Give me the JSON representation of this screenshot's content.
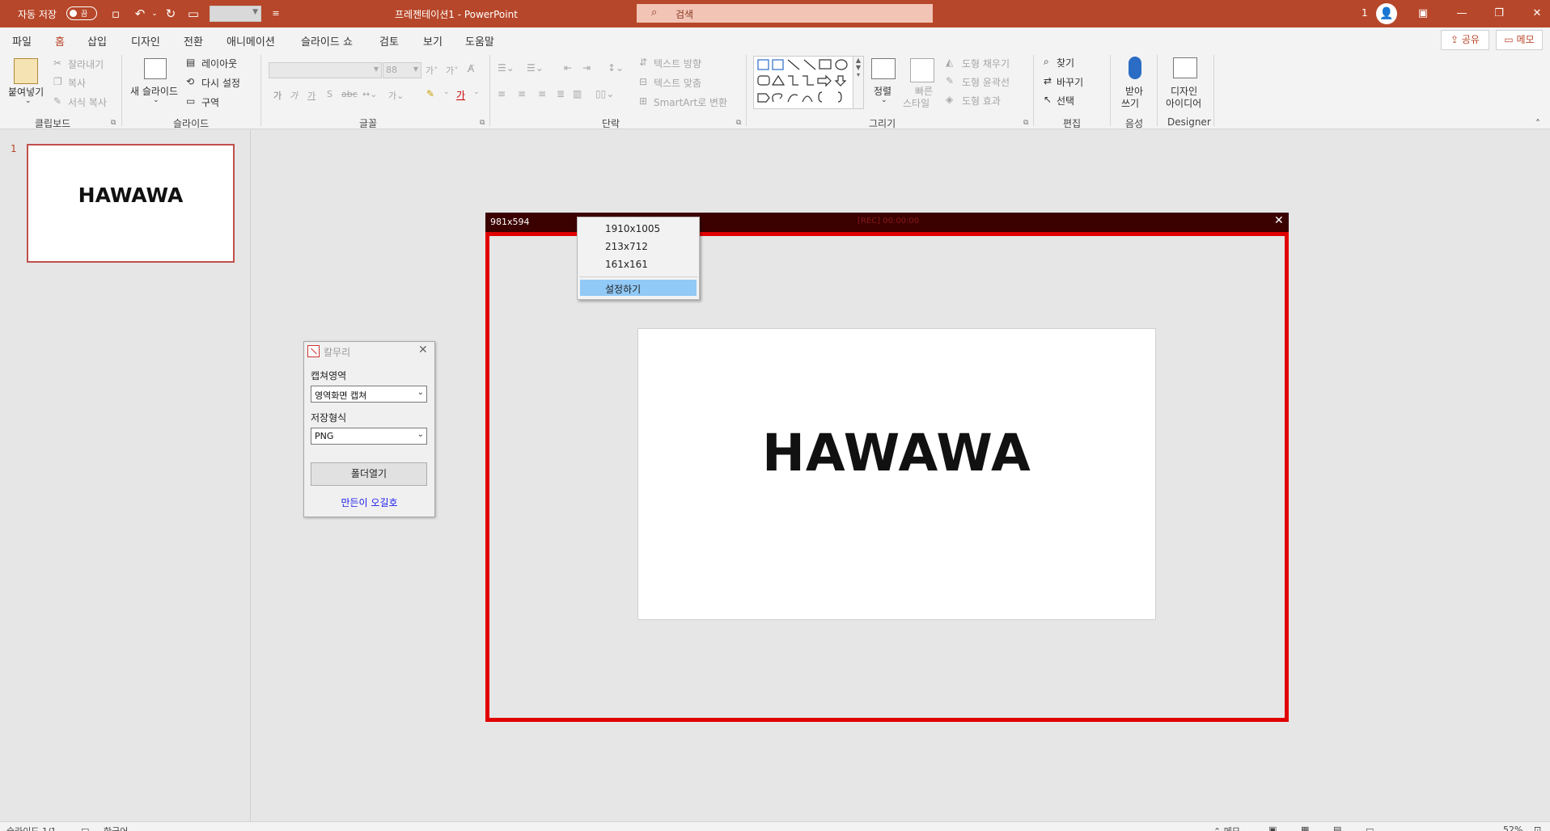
{
  "titlebar": {
    "autosave_label": "자동 저장",
    "autosave_state": "끔",
    "doc_title": "프레젠테이션1 - PowerPoint",
    "search_placeholder": "검색",
    "user_count": "1"
  },
  "menu_tabs": [
    "파일",
    "홈",
    "삽입",
    "디자인",
    "전환",
    "애니메이션",
    "슬라이드 쇼",
    "검토",
    "보기",
    "도움말"
  ],
  "share_label": "공유",
  "memo_label": "메모",
  "ribbon": {
    "clipboard": {
      "paste": "붙여넣기",
      "cut": "잘라내기",
      "copy": "복사",
      "format_painter": "서식 복사",
      "group_label": "클립보드"
    },
    "slides": {
      "new_slide": "새 슬라이드",
      "layout": "레이아웃",
      "reset": "다시 설정",
      "section": "구역",
      "group_label": "슬라이드"
    },
    "font": {
      "font_size": "88",
      "group_label": "글꼴"
    },
    "paragraph": {
      "text_direction": "텍스트 방향",
      "align_text": "텍스트 맞춤",
      "smartart": "SmartArt로 변환",
      "group_label": "단락"
    },
    "drawing": {
      "arrange": "정렬",
      "quick_styles_line1": "빠른",
      "quick_styles_line2": "스타일",
      "shape_fill": "도형 채우기",
      "shape_outline": "도형 윤곽선",
      "shape_effects": "도형 효과",
      "group_label": "그리기"
    },
    "editing": {
      "find": "찾기",
      "replace": "바꾸기",
      "select": "선택",
      "group_label": "편집"
    },
    "voice": {
      "dictate_line1": "받아",
      "dictate_line2": "쓰기",
      "group_label": "음성"
    },
    "designer": {
      "design_ideas_line1": "디자인",
      "design_ideas_line2": "아이디어",
      "group_label": "Designer"
    }
  },
  "thumbnail": {
    "number": "1",
    "text": "HAWAWA"
  },
  "capture_overlay": {
    "size_label": "981x594",
    "ghost_label": "[REC] 00:00:00"
  },
  "context_menu": {
    "items": [
      "1910x1005",
      "213x712",
      "161x161"
    ],
    "settings": "설정하기"
  },
  "slide": {
    "text": "HAWAWA"
  },
  "capture_app": {
    "title": "칼무리",
    "area_label": "캡쳐영역",
    "area_value": "영역화면 캡쳐",
    "format_label": "저장형식",
    "format_value": "PNG",
    "open_folder": "폴더열기",
    "author_link": "만든이 오길호"
  },
  "statusbar": {
    "slide_pos": "슬라이드 1/1",
    "language": "한국어",
    "notes": "메모",
    "zoom": "52%"
  },
  "colors": {
    "accent": "#b7472a",
    "capture_border": "#e00000",
    "menu_highlight": "#91c9f7"
  }
}
